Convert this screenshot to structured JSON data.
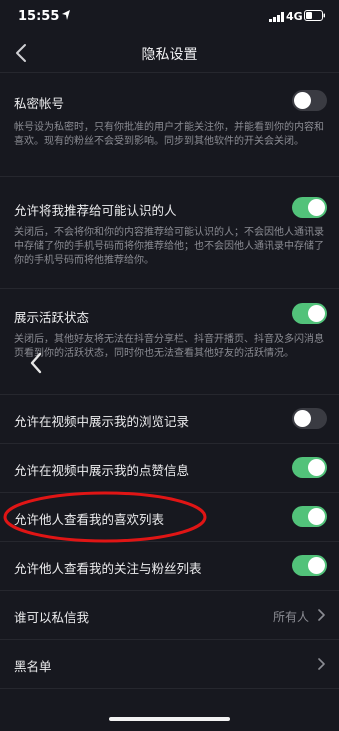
{
  "status_bar": {
    "time": "15:55",
    "network": "4G"
  },
  "header": {
    "title": "隐私设置"
  },
  "settings": {
    "private_account": {
      "label": "私密帐号",
      "description": "帐号设为私密时，只有你批准的用户才能关注你，并能看到你的内容和喜欢。现有的粉丝不会受到影响。同步到其他软件的开关会关闭。",
      "enabled": false
    },
    "recommend": {
      "label": "允许将我推荐给可能认识的人",
      "description": "关闭后，不会将你和你的内容推荐给可能认识的人；不会因他人通讯录中存储了你的手机号码而将你推荐给他；也不会因他人通讯录中存储了你的手机号码而将他推荐给你。",
      "enabled": true
    },
    "activity_status": {
      "label": "展示活跃状态",
      "description": "关闭后，其他好友将无法在抖音分享栏、抖音开播页、抖音及多闪消息页看到你的活跃状态，同时你也无法查看其他好友的活跃情况。",
      "enabled": true
    },
    "browse_history": {
      "label": "允许在视频中展示我的浏览记录",
      "enabled": false
    },
    "like_info": {
      "label": "允许在视频中展示我的点赞信息",
      "enabled": true
    },
    "likes_list": {
      "label": "允许他人查看我的喜欢列表",
      "enabled": true
    },
    "follow_list": {
      "label": "允许他人查看我的关注与粉丝列表",
      "enabled": true
    },
    "direct_message": {
      "label": "谁可以私信我",
      "value": "所有人"
    },
    "blacklist": {
      "label": "黑名单"
    }
  },
  "colors": {
    "background": "#17181f",
    "toggle_on": "#52c27a",
    "toggle_off": "#3a3b42",
    "highlight": "#e01515"
  },
  "icons": {
    "back": "chevron-left-icon",
    "row_arrow": "chevron-right-icon",
    "location": "location-arrow-icon"
  }
}
